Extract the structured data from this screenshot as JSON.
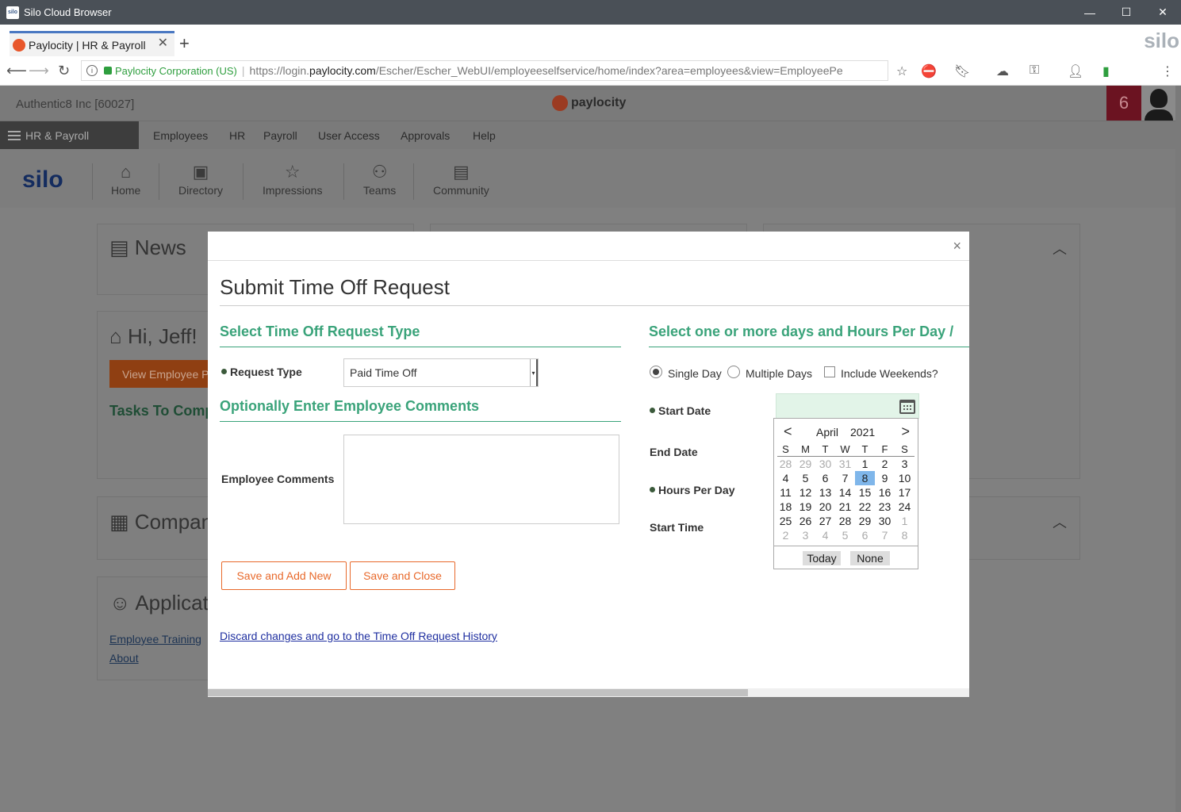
{
  "window": {
    "title": "Silo Cloud Browser",
    "logo_text": "silo",
    "minimize": "—",
    "maximize": "☐",
    "close": "✕"
  },
  "tab": {
    "title": "Paylocity | HR & Payroll",
    "close": "✕",
    "new_tab": "+"
  },
  "brand_silo": "silo",
  "address": {
    "org": "Paylocity Corporation (US)",
    "url_prefix": "https://login.",
    "url_domain": "paylocity.com",
    "url_rest": "/Escher/Escher_WebUI/employeeselfservice/home/index?area=employees&view=EmployeePe"
  },
  "app": {
    "company": "Authentic8 Inc [60027]",
    "logo_text": "paylocity",
    "notification_count": "6",
    "module_label": "HR & Payroll",
    "menu": [
      "Employees",
      "HR",
      "Payroll",
      "User Access",
      "Approvals",
      "Help"
    ]
  },
  "silobar": {
    "brand": "silo",
    "items": [
      {
        "label": "Home",
        "icon": "home-icon"
      },
      {
        "label": "Directory",
        "icon": "directory-icon"
      },
      {
        "label": "Impressions",
        "icon": "star-icon"
      },
      {
        "label": "Teams",
        "icon": "teams-icon"
      },
      {
        "label": "Community",
        "icon": "community-icon"
      }
    ]
  },
  "background": {
    "news_title": "News",
    "hi_title": "Hi, Jeff!",
    "view_employee_btn": "View Employee P",
    "tasks_title": "Tasks To Comp",
    "company_title": "Compan",
    "applications_title": "Applicat",
    "links": [
      "Employee Training",
      "About"
    ]
  },
  "modal": {
    "close": "×",
    "title": "Submit Time Off Request",
    "section_type": "Select Time Off Request Type",
    "request_type_label": "Request Type",
    "request_type_value": "Paid Time Off",
    "section_comments": "Optionally Enter Employee Comments",
    "comments_label": "Employee Comments",
    "save_add_new": "Save and Add New",
    "save_close": "Save and Close",
    "discard_link": "Discard changes and go to the Time Off Request History",
    "section_days": "Select one or more days and Hours Per Day /",
    "single_day": "Single Day",
    "multiple_days": "Multiple Days",
    "include_weekends": "Include Weekends?",
    "start_date_label": "Start Date",
    "end_date_label": "End Date",
    "hours_per_day_label": "Hours Per Day",
    "start_time_label": "Start Time"
  },
  "calendar": {
    "prev": "<",
    "next": ">",
    "month": "April",
    "year": "2021",
    "dow": [
      "S",
      "M",
      "T",
      "W",
      "T",
      "F",
      "S"
    ],
    "weeks": [
      [
        "28",
        "29",
        "30",
        "31",
        "1",
        "2",
        "3"
      ],
      [
        "4",
        "5",
        "6",
        "7",
        "8",
        "9",
        "10"
      ],
      [
        "11",
        "12",
        "13",
        "14",
        "15",
        "16",
        "17"
      ],
      [
        "18",
        "19",
        "20",
        "21",
        "22",
        "23",
        "24"
      ],
      [
        "25",
        "26",
        "27",
        "28",
        "29",
        "30",
        "1"
      ],
      [
        "2",
        "3",
        "4",
        "5",
        "6",
        "7",
        "8"
      ]
    ],
    "selected_day": "8",
    "today_btn": "Today",
    "none_btn": "None"
  },
  "colors": {
    "accent_green": "#3aa37a",
    "orange": "#e8692b",
    "selected_day": "#7fb6ea"
  }
}
